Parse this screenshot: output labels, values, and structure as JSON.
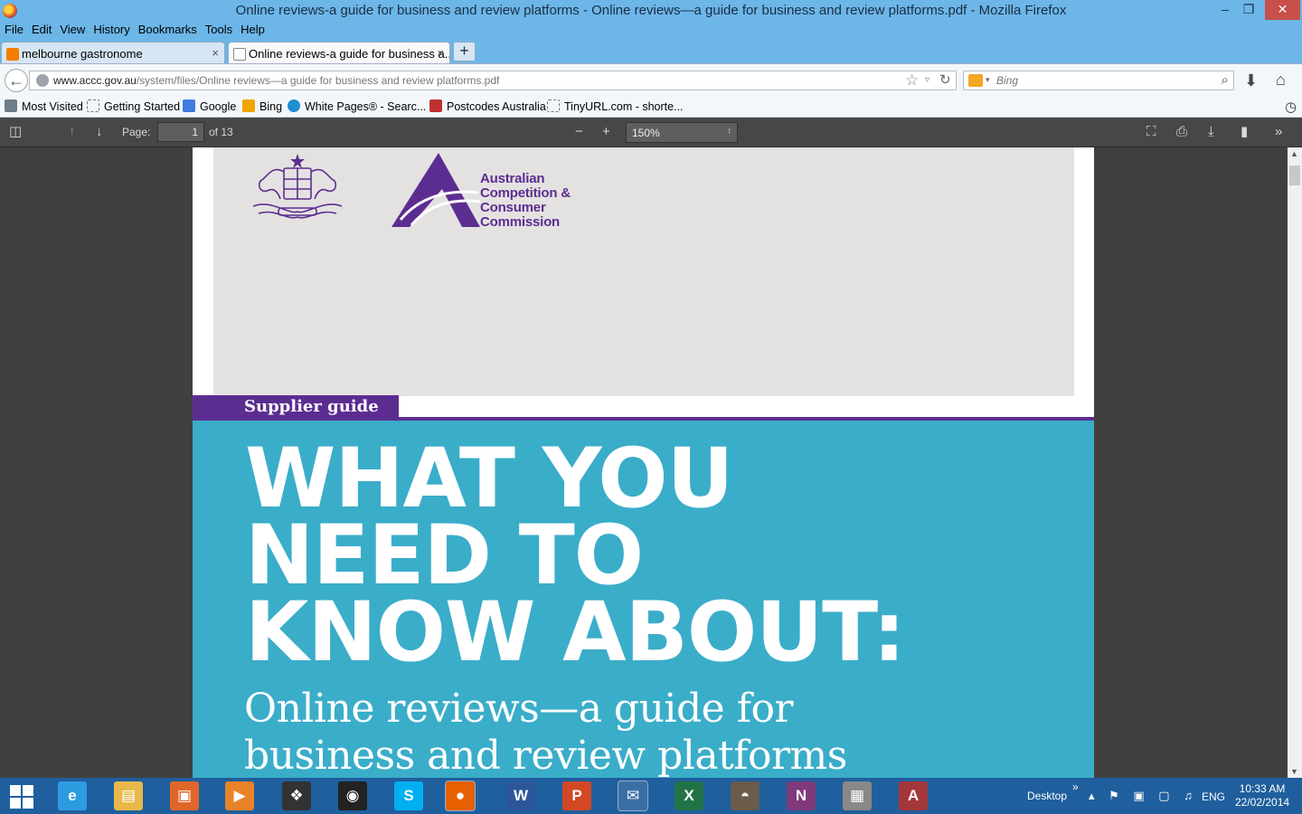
{
  "window": {
    "title": "Online reviews-a guide for business and review platforms - Online reviews—a guide for business and review platforms.pdf - Mozilla Firefox",
    "minimize": "–",
    "restore": "❐",
    "close": "✕"
  },
  "menu": [
    "File",
    "Edit",
    "View",
    "History",
    "Bookmarks",
    "Tools",
    "Help"
  ],
  "tabs": [
    {
      "label": "melbourne gastronome",
      "icon": "blogger-icon",
      "active": false
    },
    {
      "label": "Online reviews-a guide for business a...",
      "icon": "page-icon",
      "active": true
    }
  ],
  "tab_close": "×",
  "new_tab": "+",
  "nav": {
    "back": "←",
    "url_domain": "www.accc.gov.au",
    "url_path": "/system/files/Online reviews—a guide for business and review platforms.pdf",
    "search_placeholder": "Bing",
    "star": "☆",
    "dropdown": "▿",
    "reload": "↻",
    "search_drop": "▾",
    "search_glass": "⌕",
    "download": "⬇",
    "home": "⌂"
  },
  "bookmarks": [
    {
      "label": "Most Visited",
      "icon": "most-visited-icon"
    },
    {
      "label": "Getting Started",
      "icon": "page-icon"
    },
    {
      "label": "Google",
      "icon": "google-icon"
    },
    {
      "label": "Bing",
      "icon": "bing-icon"
    },
    {
      "label": "White Pages® - Searc...",
      "icon": "whitepages-icon"
    },
    {
      "label": "Postcodes Australia",
      "icon": "postcodes-icon"
    },
    {
      "label": "TinyURL.com - shorte...",
      "icon": "page-icon"
    }
  ],
  "bookmarks_history_glyph": "◷",
  "pdf_toolbar": {
    "sidebar": "◫",
    "prev": "↑",
    "next": "↓",
    "page_label": "Page:",
    "page_value": "1",
    "page_count": "of 13",
    "zoom_out": "−",
    "zoom_in": "+",
    "zoom_value": "150%",
    "zoom_arrow": "↕",
    "fullscreen": "⛶",
    "print": "⎙",
    "save": "⤓",
    "bookmark": "▮",
    "tools": "»"
  },
  "document": {
    "agency_lines": [
      "Australian",
      "Competition &",
      "Consumer",
      "Commission"
    ],
    "badge": "Supplier guide",
    "headline": [
      "WHAT YOU",
      "NEED TO",
      "KNOW ABOUT:"
    ],
    "subtitle": [
      "Online reviews—a guide for",
      "business and review platforms"
    ]
  },
  "scrollbar": {
    "up": "▲",
    "down": "▼"
  },
  "taskbar": {
    "apps": [
      {
        "name": "internet-explorer-icon",
        "glyph": "e",
        "color": "#2d9be0"
      },
      {
        "name": "file-explorer-icon",
        "glyph": "▤",
        "color": "#e8b94a"
      },
      {
        "name": "photo-app-icon",
        "glyph": "▣",
        "color": "#e0662a"
      },
      {
        "name": "media-player-icon",
        "glyph": "▶",
        "color": "#e8832a"
      },
      {
        "name": "puzzle-app-icon",
        "glyph": "❖",
        "color": "#333333"
      },
      {
        "name": "media-center-icon",
        "glyph": "◉",
        "color": "#222222"
      },
      {
        "name": "skype-icon",
        "glyph": "S",
        "color": "#00aff0"
      },
      {
        "name": "firefox-icon",
        "glyph": "●",
        "color": "#e66000"
      },
      {
        "name": "word-icon",
        "glyph": "W",
        "color": "#2b579a"
      },
      {
        "name": "powerpoint-icon",
        "glyph": "P",
        "color": "#d24726"
      },
      {
        "name": "thunderbird-icon",
        "glyph": "✉",
        "color": "#3a6ea5"
      },
      {
        "name": "excel-icon",
        "glyph": "X",
        "color": "#217346"
      },
      {
        "name": "gimp-icon",
        "glyph": "◓",
        "color": "#6b5b4a"
      },
      {
        "name": "onenote-icon",
        "glyph": "N",
        "color": "#80397b"
      },
      {
        "name": "firewall-icon",
        "glyph": "▦",
        "color": "#888888"
      },
      {
        "name": "access-icon",
        "glyph": "A",
        "color": "#a4373a"
      }
    ],
    "desktop_label": "Desktop",
    "tray_chevron": "»",
    "tray_glyphs": "▴ ⚑ ▣ ▢ ♫",
    "language": "ENG",
    "time": "10:33 AM",
    "date": "22/02/2014"
  }
}
